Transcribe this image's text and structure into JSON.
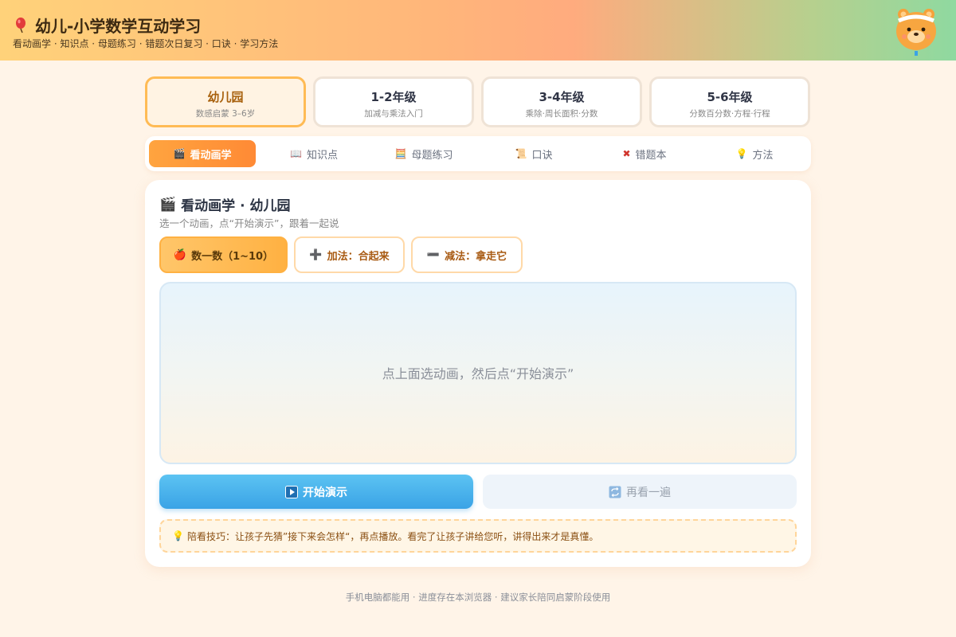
{
  "header": {
    "title": "幼儿-小学数学互动学习",
    "subtitle": "看动画学 · 知识点 · 母题练习 · 错题次日复习 · 口诀 · 学习方法",
    "logo_icon": "balloon-icon",
    "mascot_icon": "bear-mascot-icon"
  },
  "grades": [
    {
      "label": "幼儿园",
      "desc": "数感启蒙 3–6岁",
      "active": true
    },
    {
      "label": "1-2年级",
      "desc": "加减与乘法入门",
      "active": false
    },
    {
      "label": "3-4年级",
      "desc": "乘除·周长面积·分数",
      "active": false
    },
    {
      "label": "5-6年级",
      "desc": "分数百分数·方程·行程",
      "active": false
    }
  ],
  "tabs": [
    {
      "icon": "clapper-icon",
      "glyph": "🎬",
      "label": "看动画学",
      "active": true
    },
    {
      "icon": "book-icon",
      "glyph": "📖",
      "label": "知识点",
      "active": false
    },
    {
      "icon": "abacus-icon",
      "glyph": "🧮",
      "label": "母题练习",
      "active": false
    },
    {
      "icon": "scroll-icon",
      "glyph": "📜",
      "label": "口诀",
      "active": false
    },
    {
      "icon": "cross-icon",
      "glyph": "✖",
      "label": "错题本",
      "active": false
    },
    {
      "icon": "bulb-icon",
      "glyph": "💡",
      "label": "方法",
      "active": false
    }
  ],
  "panel": {
    "title": "看动画学 · 幼儿园",
    "title_icon": "clapper-icon",
    "subtitle": "选一个动画，点“开始演示”，跟着一起说",
    "animations": [
      {
        "icon": "apple-icon",
        "glyph": "🍎",
        "label": "数一数（1~10）",
        "active": true
      },
      {
        "icon": "plus-icon",
        "glyph": "➕",
        "label": "加法：合起来",
        "active": false
      },
      {
        "icon": "minus-icon",
        "glyph": "➖",
        "label": "减法：拿走它",
        "active": false
      }
    ],
    "stage_hint": "点上面选动画，然后点“开始演示”",
    "play_label": "开始演示",
    "play_icon": "play-icon",
    "replay_label": "再看一遍",
    "replay_icon": "repeat-icon",
    "tip": "陪看技巧：让孩子先猜”接下来会怎样“，再点播放。看完了让孩子讲给您听，讲得出来才是真懂。",
    "tip_icon": "bulb-icon"
  },
  "footer": "手机电脑都能用 · 进度存在本浏览器 · 建议家长陪同启蒙阶段使用",
  "colors": {
    "accent": "#ff9a3a",
    "play": "#3aa3e6",
    "background": "#fff4e8"
  }
}
